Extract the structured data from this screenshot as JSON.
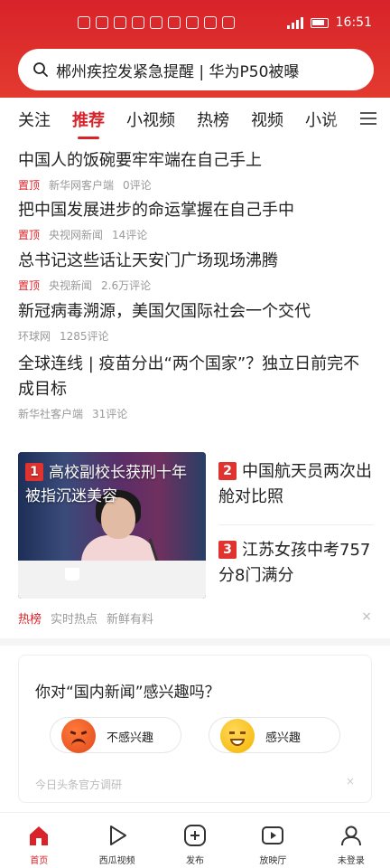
{
  "status_bar": {
    "time": "16:51"
  },
  "search": {
    "text": "郴州疾控发紧急提醒 | 华为P50被曝"
  },
  "tabs": [
    {
      "label": "关注"
    },
    {
      "label": "推荐",
      "active": true
    },
    {
      "label": "小视频"
    },
    {
      "label": "热榜"
    },
    {
      "label": "视频"
    },
    {
      "label": "小说"
    }
  ],
  "news": [
    {
      "title": "中国人的饭碗要牢牢端在自己手上",
      "tag": "置顶",
      "source": "新华网客户端",
      "comments": "0评论"
    },
    {
      "title": "把中国发展进步的命运掌握在自己手中",
      "tag": "置顶",
      "source": "央视网新闻",
      "comments": "14评论"
    },
    {
      "title": "总书记这些话让天安门广场现场沸腾",
      "tag": "置顶",
      "source": "央视新闻",
      "comments": "2.6万评论"
    },
    {
      "title": "新冠病毒溯源，美国欠国际社会一个交代",
      "tag": "",
      "source": "环球网",
      "comments": "1285评论"
    },
    {
      "title": "全球连线 | 疫苗分出“两个国家”？独立日前完不成目标",
      "tag": "",
      "source": "新华社客户端",
      "comments": "31评论"
    }
  ],
  "hot": {
    "items": [
      {
        "rank": "1",
        "title": "高校副校长获刑十年 被指沉迷美容"
      },
      {
        "rank": "2",
        "title": "中国航天员两次出舱对比照"
      },
      {
        "rank": "3",
        "title": "江苏女孩中考757分8门满分"
      }
    ],
    "tags": [
      "热榜",
      "实时热点",
      "新鲜有料"
    ],
    "close": "×"
  },
  "interest": {
    "question": "你对“国内新闻”感兴趣吗？",
    "not_interested": "不感兴趣",
    "interested": "感兴趣",
    "footer": "今日头条官方调研",
    "close": "×"
  },
  "bottom_nav": [
    {
      "label": "首页",
      "icon": "home-icon",
      "active": true
    },
    {
      "label": "西瓜视频",
      "icon": "play-icon"
    },
    {
      "label": "发布",
      "icon": "plus-icon"
    },
    {
      "label": "放映厅",
      "icon": "video-icon"
    },
    {
      "label": "未登录",
      "icon": "user-icon"
    }
  ],
  "colors": {
    "brand_red": "#d8232a",
    "text": "#222222",
    "meta_gray": "#999999"
  }
}
